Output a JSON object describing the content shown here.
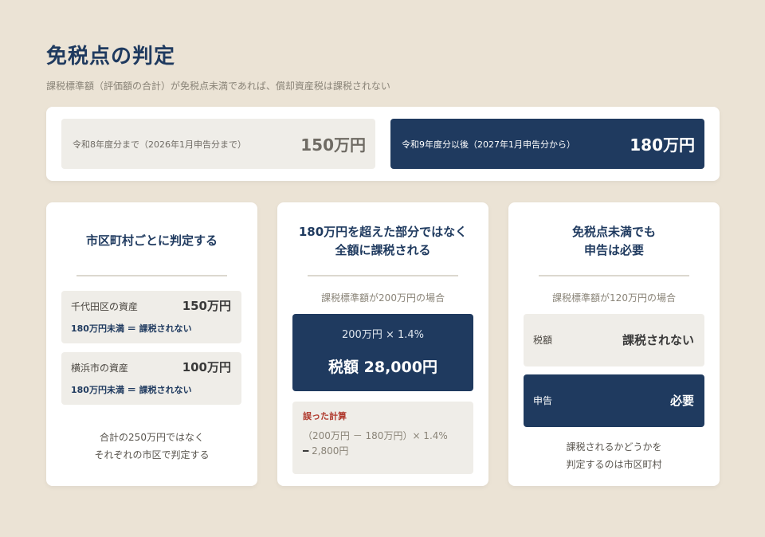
{
  "header": {
    "title": "免税点の判定",
    "subtitle": "課税標準額（評価額の合計）が免税点未満であれば、償却資産税は課税されない"
  },
  "thresholds": [
    {
      "label": "令和8年度分まで（2026年1月申告分まで）",
      "value": "150万円"
    },
    {
      "label": "令和9年度分以後（2027年1月申告分から）",
      "value": "180万円"
    }
  ],
  "cards": {
    "municipal": {
      "title": "市区町村ごとに判定する",
      "assets": [
        {
          "name": "千代田区の資産",
          "value": "150万円",
          "status": "180万円未満 ＝ 課税されない"
        },
        {
          "name": "横浜市の資産",
          "value": "100万円",
          "status": "180万円未満 ＝ 課税されない"
        }
      ],
      "footer": [
        "合計の250万円ではなく",
        "それぞれの市区で判定する"
      ]
    },
    "full_amount": {
      "title_lines": [
        "180万円を超えた部分ではなく",
        "全額に課税される"
      ],
      "case_label": "課税標準額が200万円の場合",
      "formula": "200万円 × 1.4%",
      "result": "税額 28,000円",
      "wrong_label": "誤った計算",
      "wrong_formula": "（200万円 － 180万円）× 1.4%",
      "wrong_mark": "━",
      "wrong_result": "2,800円"
    },
    "filing": {
      "title_lines": [
        "免税点未満でも",
        "申告は必要"
      ],
      "case_label": "課税標準額が120万円の場合",
      "rows": [
        {
          "label": "税額",
          "value": "課税されない"
        },
        {
          "label": "申告",
          "value": "必要"
        }
      ],
      "footer": [
        "課税されるかどうかを",
        "判定するのは市区町村"
      ]
    }
  },
  "colors": {
    "background": "#ebe3d5",
    "navy": "#1f3a5f",
    "light_box": "#efede8",
    "error_red": "#b03a2e"
  }
}
